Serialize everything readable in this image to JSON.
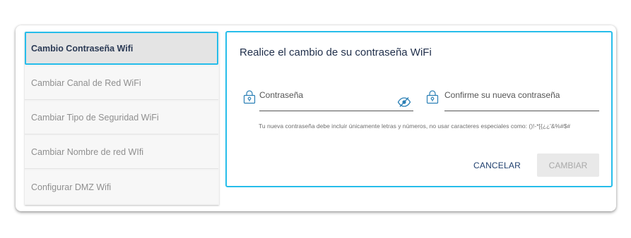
{
  "sidebar": {
    "items": [
      {
        "label": "Cambio Contraseña Wifi",
        "active": true
      },
      {
        "label": "Cambiar Canal de Red WiFi",
        "active": false
      },
      {
        "label": "Cambiar Tipo de Seguridad WiFi",
        "active": false
      },
      {
        "label": "Cambiar Nombre de red WIfi",
        "active": false
      },
      {
        "label": "Configurar DMZ Wifi",
        "active": false
      }
    ]
  },
  "panel": {
    "title": "Realice el cambio de su contraseña WiFi",
    "password": {
      "label": "Contraseña",
      "value": ""
    },
    "confirm": {
      "label": "Confirme su nueva contraseña",
      "value": ""
    },
    "hint": "Tu nueva contraseña debe incluir únicamente letras y números, no usar caracteres especiales como: ()!-*[{¿¿'&%#$#",
    "cancel_label": "CANCELAR",
    "submit_label": "CAMBIAR"
  },
  "colors": {
    "accent": "#26bdea",
    "title": "#1f2e4a",
    "disabled_bg": "#e9e9e9",
    "icon": "#2a7fb5"
  }
}
